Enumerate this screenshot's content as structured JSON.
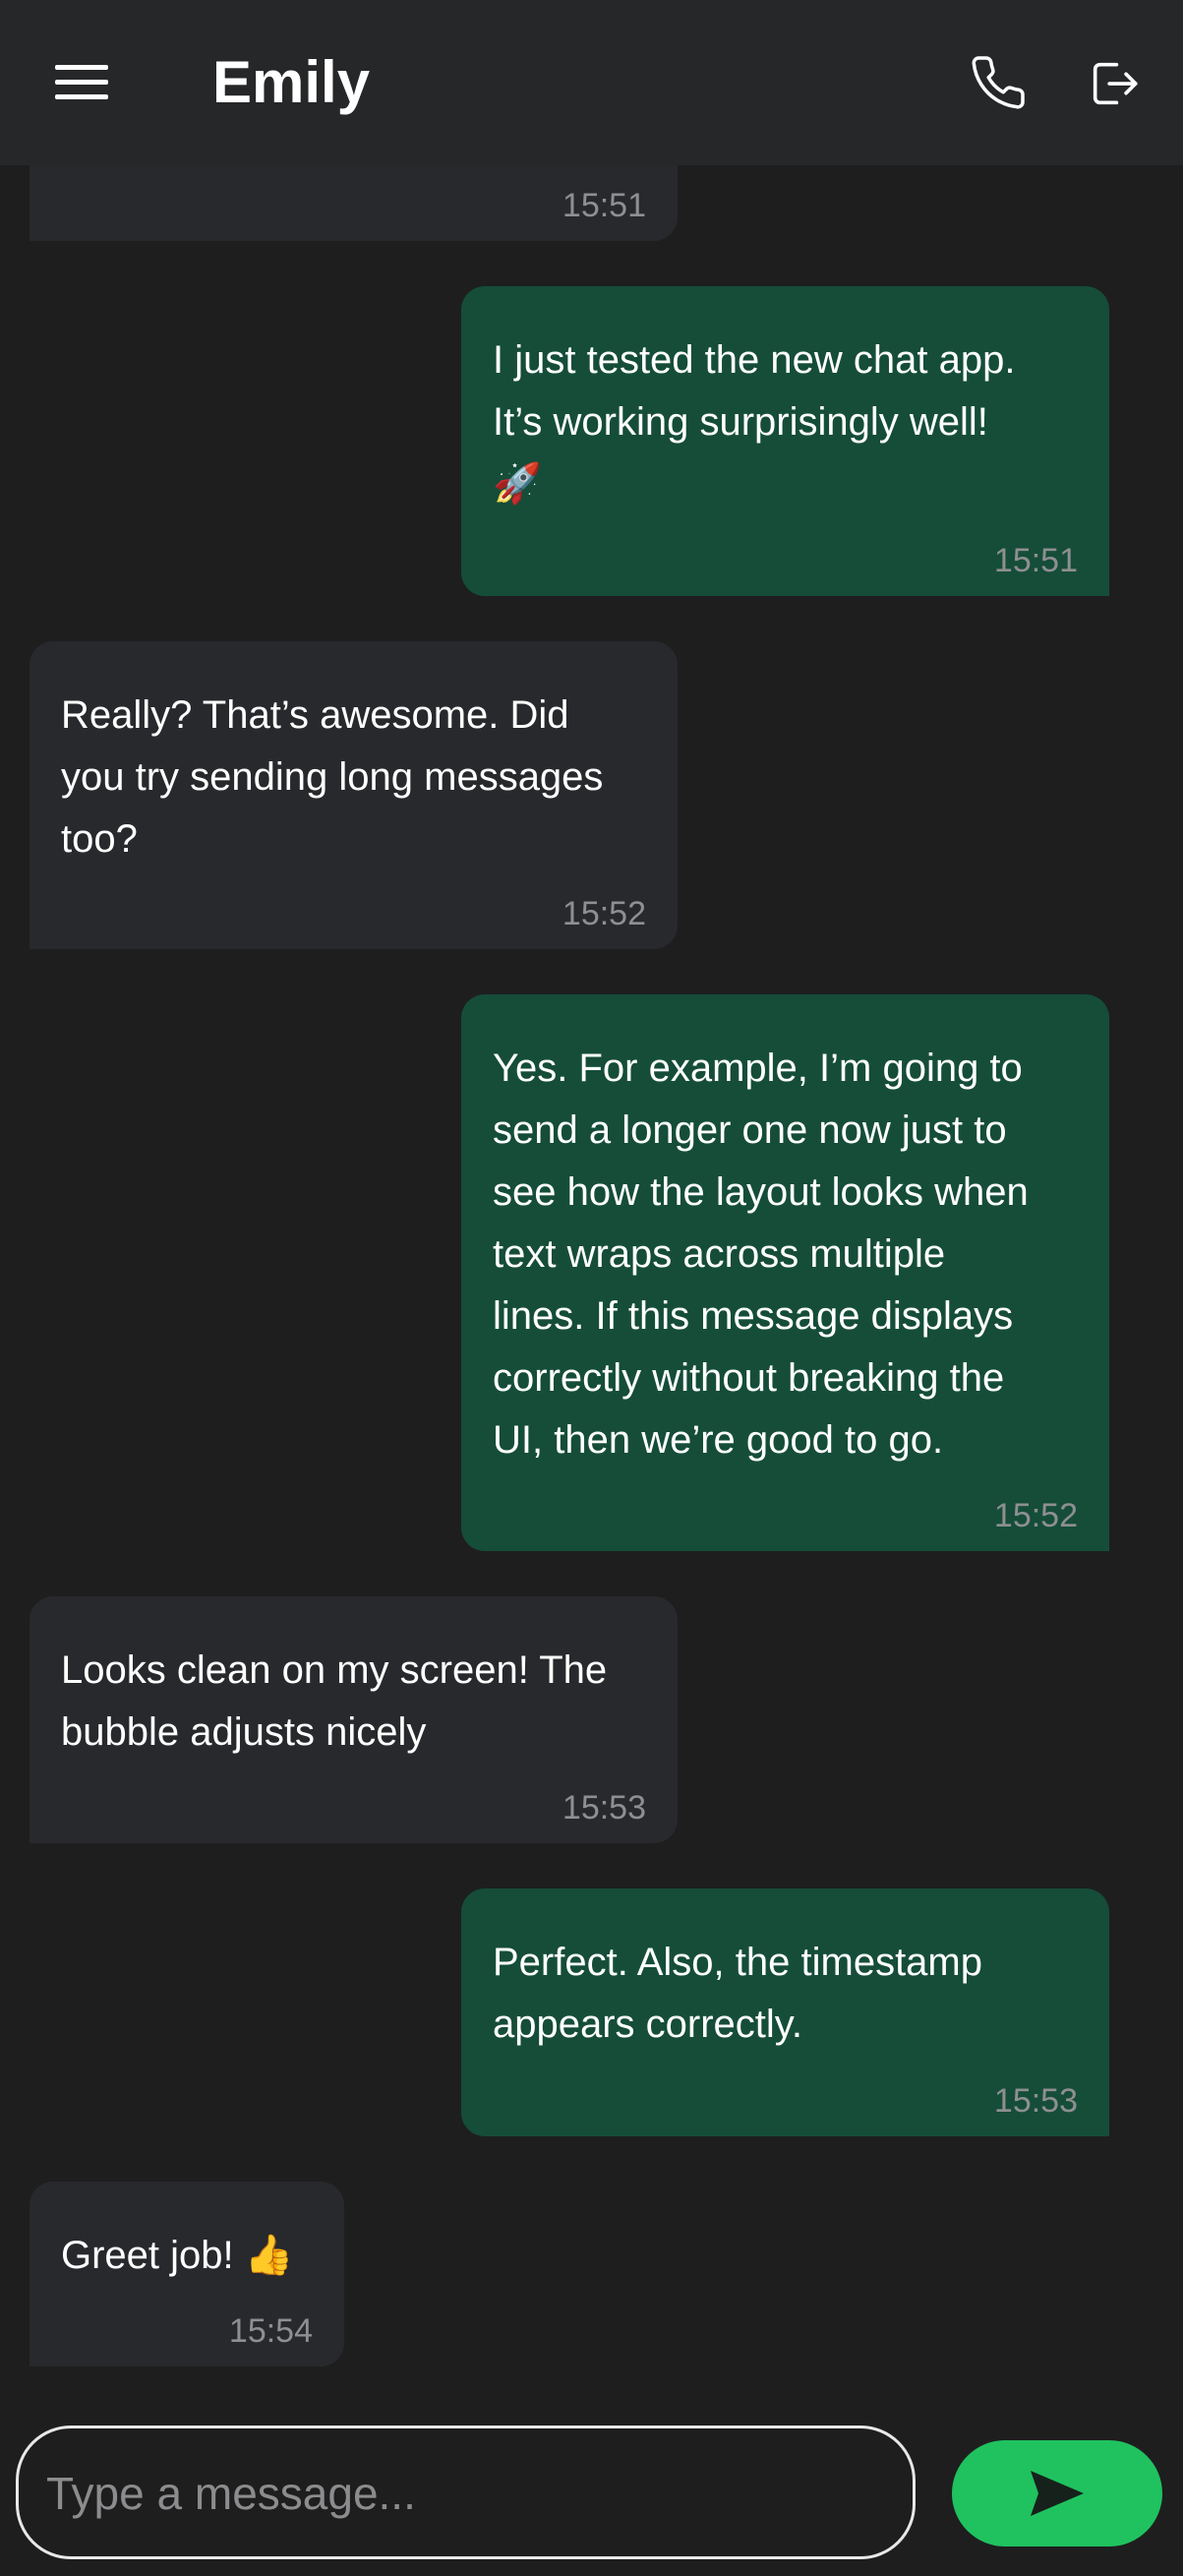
{
  "header": {
    "title": "Emily",
    "menu_icon": "hamburger-menu-icon",
    "call_icon": "phone-icon",
    "logout_icon": "logout-icon"
  },
  "messages": [
    {
      "direction": "incoming",
      "text": "",
      "time": "15:51"
    },
    {
      "direction": "outgoing",
      "text": "I just tested the new chat app.\nIt’s working surprisingly well!\n🚀",
      "time": "15:51"
    },
    {
      "direction": "incoming",
      "text": "Really? That’s awesome. Did\nyou try sending long messages\ntoo?",
      "time": "15:52"
    },
    {
      "direction": "outgoing",
      "text": "Yes. For example, I’m going to\nsend a longer one now just to\nsee how the layout looks when\ntext wraps across multiple\nlines. If this message displays\ncorrectly without breaking the\nUI, then we’re good to go.",
      "time": "15:52"
    },
    {
      "direction": "incoming",
      "text": "Looks clean on my screen! The\nbubble adjusts nicely",
      "time": "15:53"
    },
    {
      "direction": "outgoing",
      "text": "Perfect. Also, the timestamp\nappears correctly.",
      "time": "15:53"
    },
    {
      "direction": "incoming",
      "text": "Greet job! 👍",
      "time": "15:54"
    }
  ],
  "composer": {
    "placeholder": "Type a message...",
    "value": "",
    "send_icon": "send-icon"
  },
  "colors": {
    "background": "#1e1e1f",
    "header": "#262729",
    "incoming_bubble": "#28292c",
    "outgoing_bubble": "#154d39",
    "send_button": "#1fc25f"
  }
}
